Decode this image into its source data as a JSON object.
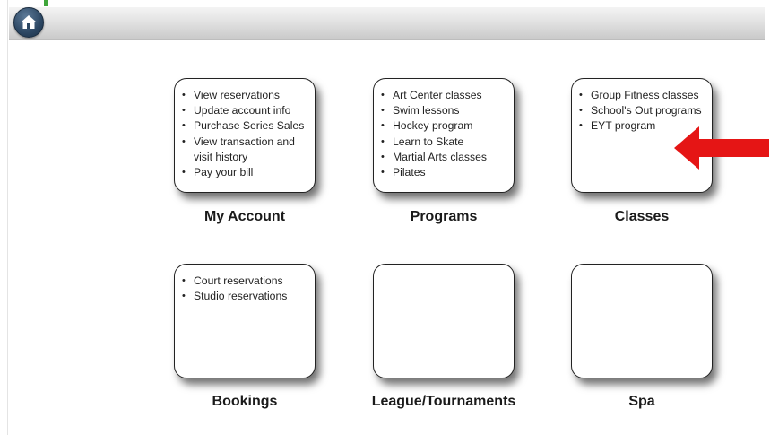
{
  "tiles": [
    {
      "title": "My Account",
      "items": [
        "View reservations",
        "Update account info",
        "Purchase Series Sales",
        "View transaction and",
        "visit history",
        "Pay your bill"
      ],
      "bullets": [
        true,
        true,
        true,
        true,
        false,
        true
      ]
    },
    {
      "title": "Programs",
      "items": [
        "Art Center classes",
        "Swim lessons",
        "Hockey program",
        "Learn to Skate",
        "Martial Arts classes",
        "Pilates"
      ],
      "bullets": [
        true,
        true,
        true,
        true,
        true,
        true
      ]
    },
    {
      "title": "Classes",
      "items": [
        "Group Fitness classes",
        "School's Out programs",
        "EYT program"
      ],
      "bullets": [
        true,
        true,
        true
      ]
    },
    {
      "title": "Bookings",
      "items": [
        "Court reservations",
        "Studio reservations"
      ],
      "bullets": [
        true,
        true
      ]
    },
    {
      "title": "League/Tournaments",
      "items": [],
      "bullets": []
    },
    {
      "title": "Spa",
      "items": [],
      "bullets": []
    }
  ],
  "icons": {
    "home": "home-icon",
    "arrow": "red-arrow-icon"
  },
  "colors": {
    "arrow": "#e51515",
    "accent_green": "#3fa63a",
    "home_button": "#2c4763"
  }
}
